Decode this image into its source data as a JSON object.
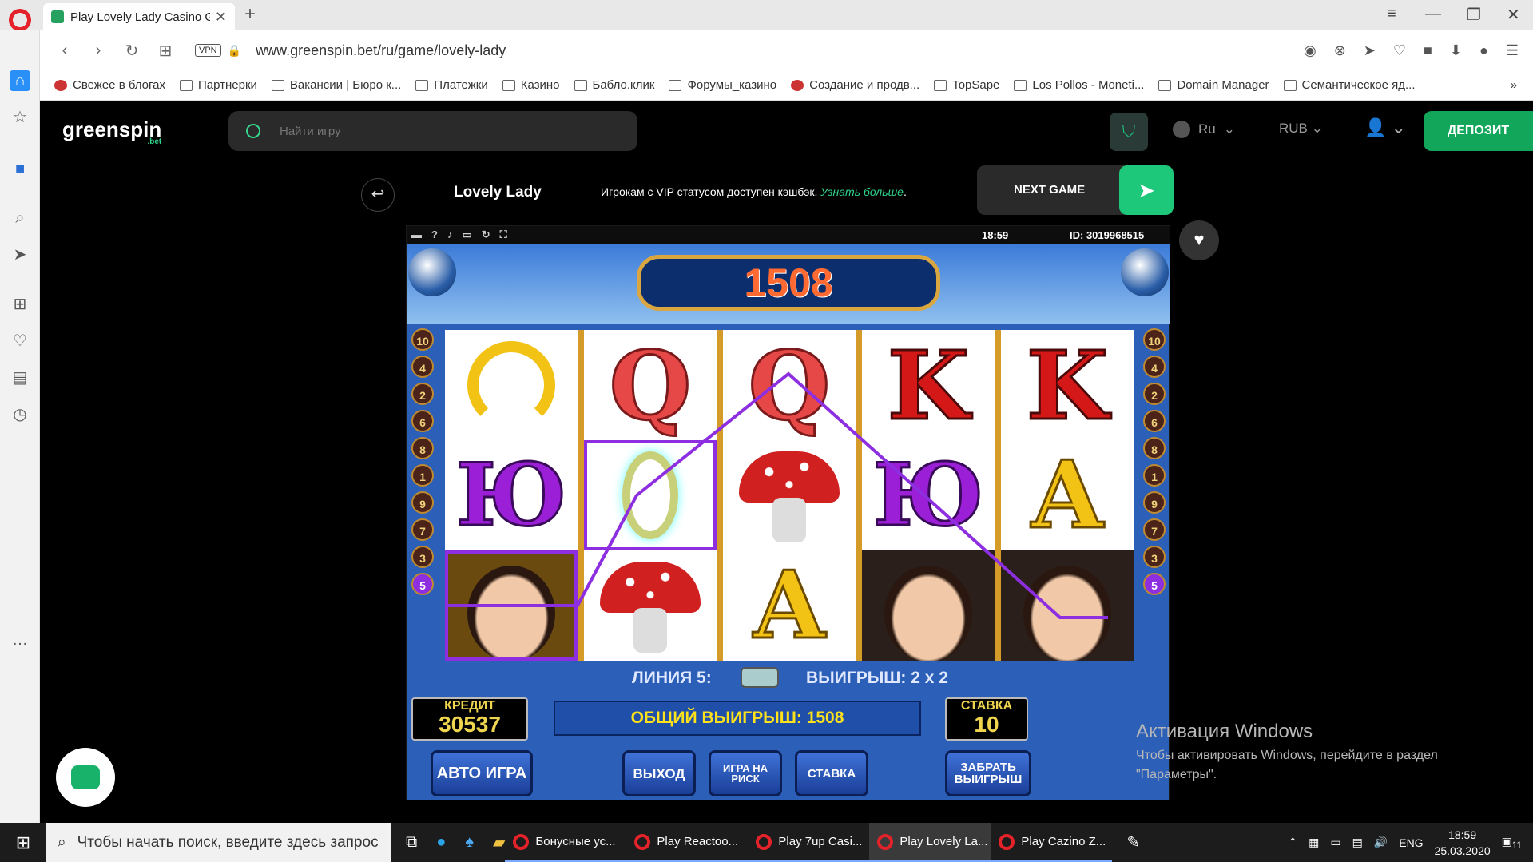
{
  "browser": {
    "tab_title": "Play Lovely Lady Casino Ga",
    "url": "www.greenspin.bet/ru/game/lovely-lady",
    "vpn": "VPN",
    "bookmarks": [
      "Свежее в блогах",
      "Партнерки",
      "Вакансии | Бюро к...",
      "Платежки",
      "Казино",
      "Бабло.клик",
      "Форумы_казино",
      "Создание и продв...",
      "TopSape",
      "Los Pollos - Moneti...",
      "Domain Manager",
      "Семантическое яд..."
    ]
  },
  "site": {
    "logo": "greenspin",
    "logo_sub": ".bet",
    "search_placeholder": "Найти игру",
    "lang": "Ru",
    "currency": "RUB",
    "deposit": "ДЕПОЗИТ",
    "game_title": "Lovely Lady",
    "vip_note": "Игрокам с VIP статусом доступен кэшбэк.",
    "vip_link": "Узнать больше",
    "next_game": "NEXT GAME"
  },
  "game": {
    "time": "18:59",
    "id": "ID: 3019968515",
    "win_display": "1508",
    "line_text": "ЛИНИЯ 5:",
    "line_win": "ВЫИГРЫШ: 2 x 2",
    "credit_label": "КРЕДИТ",
    "credit_value": "30537",
    "bet_label": "СТАВКА",
    "bet_value": "10",
    "total_win": "ОБЩИЙ ВЫИГРЫШ: 1508",
    "btn_auto": "АВТО ИГРА",
    "btn_exit": "ВЫХОД",
    "btn_risk": "ИГРА НА РИСК",
    "btn_stake": "СТАВКА",
    "btn_take": "ЗАБРАТЬ ВЫИГРЫШ",
    "left_lines": [
      "10",
      "4",
      "2",
      "6",
      "8",
      "1",
      "9",
      "7",
      "3",
      "5"
    ],
    "right_lines": [
      "10",
      "4",
      "2",
      "6",
      "8",
      "1",
      "9",
      "7",
      "3",
      "5"
    ],
    "reels": [
      [
        "horseshoe",
        "Ю",
        "lady"
      ],
      [
        "Q",
        "ring",
        "mushroom"
      ],
      [
        "Q",
        "mushroom",
        "A"
      ],
      [
        "K",
        "Ю",
        "lady"
      ],
      [
        "K",
        "A",
        "lady"
      ]
    ]
  },
  "windows": {
    "activation_title": "Активация Windows",
    "activation_sub": "Чтобы активировать Windows, перейдите в раздел \"Параметры\".",
    "search_placeholder": "Чтобы начать поиск, введите здесь запрос",
    "tasks": [
      "Бонусные ус...",
      "Play Reactoo...",
      "Play 7up Casi...",
      "Play Lovely La...",
      "Play Cazino Z..."
    ],
    "lang": "ENG",
    "time": "18:59",
    "date": "25.03.2020",
    "notifications": "11"
  }
}
